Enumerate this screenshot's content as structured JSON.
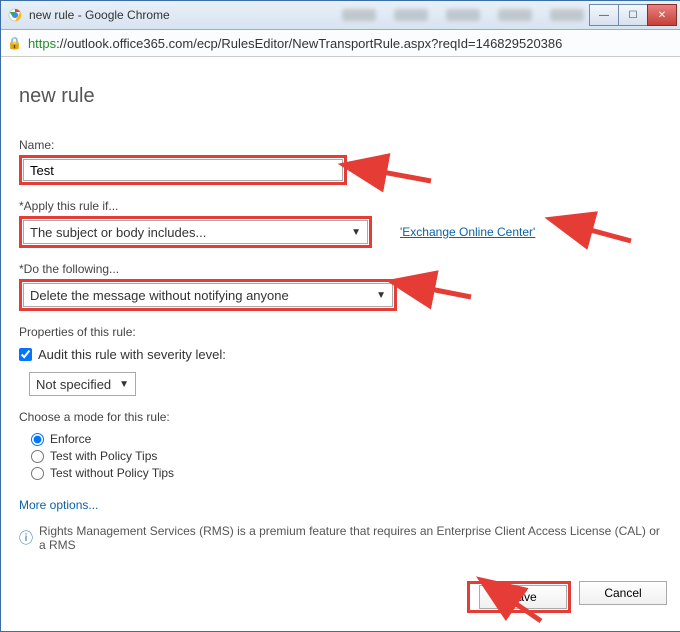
{
  "window": {
    "title": "new rule - Google Chrome",
    "url_scheme": "https",
    "url_rest": "://outlook.office365.com/ecp/RulesEditor/NewTransportRule.aspx?reqId=146829520386"
  },
  "page": {
    "heading": "new rule",
    "name_label": "Name:",
    "name_value": "Test",
    "apply_label": "Apply this rule if...",
    "apply_value": "The subject or body includes...",
    "match_value": "'Exchange Online Center'",
    "do_label": "Do the following...",
    "do_value": "Delete the message without notifying anyone",
    "props_label": "Properties of this rule:",
    "audit_label": "Audit this rule with severity level:",
    "severity_value": "Not specified",
    "mode_label": "Choose a mode for this rule:",
    "modes": {
      "enforce": "Enforce",
      "tips": "Test with Policy Tips",
      "notips": "Test without Policy Tips"
    },
    "more_options": "More options...",
    "info": "Rights Management Services (RMS) is a premium feature that requires an Enterprise Client Access License (CAL) or a RMS"
  },
  "footer": {
    "save": "Save",
    "cancel": "Cancel"
  }
}
